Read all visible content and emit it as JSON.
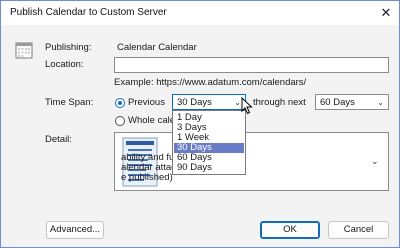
{
  "window": {
    "title": "Publish Calendar to Custom Server",
    "close_glyph": "✕"
  },
  "form": {
    "publishing_label": "Publishing:",
    "publishing_value": "Calendar Calendar",
    "location_label": "Location:",
    "location_value": "",
    "example_text": "Example: https://www.adatum.com/calendars/",
    "timespan_label": "Time Span:",
    "previous_label": "Previous",
    "previous_value": "30 Days",
    "through_next_label": "through next",
    "next_value": "60 Days",
    "whole_calendar_label": "Whole cale",
    "detail_label": "Detail:",
    "detail_lines": [
      "ability and full details of",
      "alendar attachments will not",
      "e published)"
    ]
  },
  "dropdown": {
    "options": [
      "1 Day",
      "3 Days",
      "1 Week",
      "30 Days",
      "60 Days",
      "90 Days"
    ],
    "selected_index": 3
  },
  "buttons": {
    "advanced": "Advanced...",
    "ok": "OK",
    "cancel": "Cancel"
  },
  "colors": {
    "accent": "#0f6cbd",
    "dropdown_highlight": "#6a7bc8"
  },
  "icons": {
    "calendar": "calendar-icon",
    "detail_preview": "document-preview-icon",
    "close": "close-icon",
    "chevron": "chevron-down-icon",
    "pointer": "mouse-pointer-icon"
  }
}
